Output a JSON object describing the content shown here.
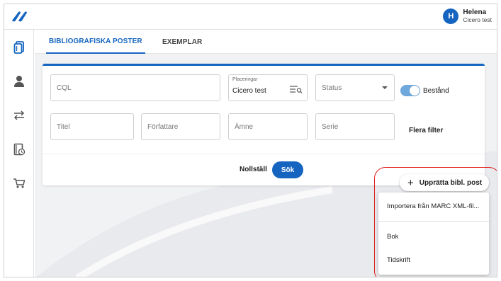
{
  "user": {
    "initial": "H",
    "name": "Helena",
    "org": "Cicero test"
  },
  "tabs": [
    {
      "label": "BIBLIOGRAFISKA POSTER",
      "active": true
    },
    {
      "label": "EXEMPLAR",
      "active": false
    }
  ],
  "sidebar": {
    "icons": [
      "books-icon",
      "user-icon",
      "transfer-arrows-icon",
      "book-clock-icon",
      "cart-icon"
    ]
  },
  "filters": {
    "cql_placeholder": "CQL",
    "location_label": "Placeringar",
    "location_value": "Cicero test",
    "status_placeholder": "Status",
    "holdings_label": "Bestånd",
    "holdings_on": true,
    "title_placeholder": "Titel",
    "author_placeholder": "Författare",
    "subject_placeholder": "Ämne",
    "series_placeholder": "Serie",
    "more_filters_label": "Flera filter"
  },
  "actions": {
    "reset_label": "Nollställ",
    "search_label": "Sök",
    "create_label": "Upprätta bibl. post",
    "create_icon": "+"
  },
  "create_menu": {
    "items": [
      "Importera från MARC XML-fil...",
      "Bok",
      "Tidskrift"
    ]
  },
  "colors": {
    "accent": "#1565c0",
    "toggle": "#6fa8dc",
    "highlight": "#e02020"
  }
}
